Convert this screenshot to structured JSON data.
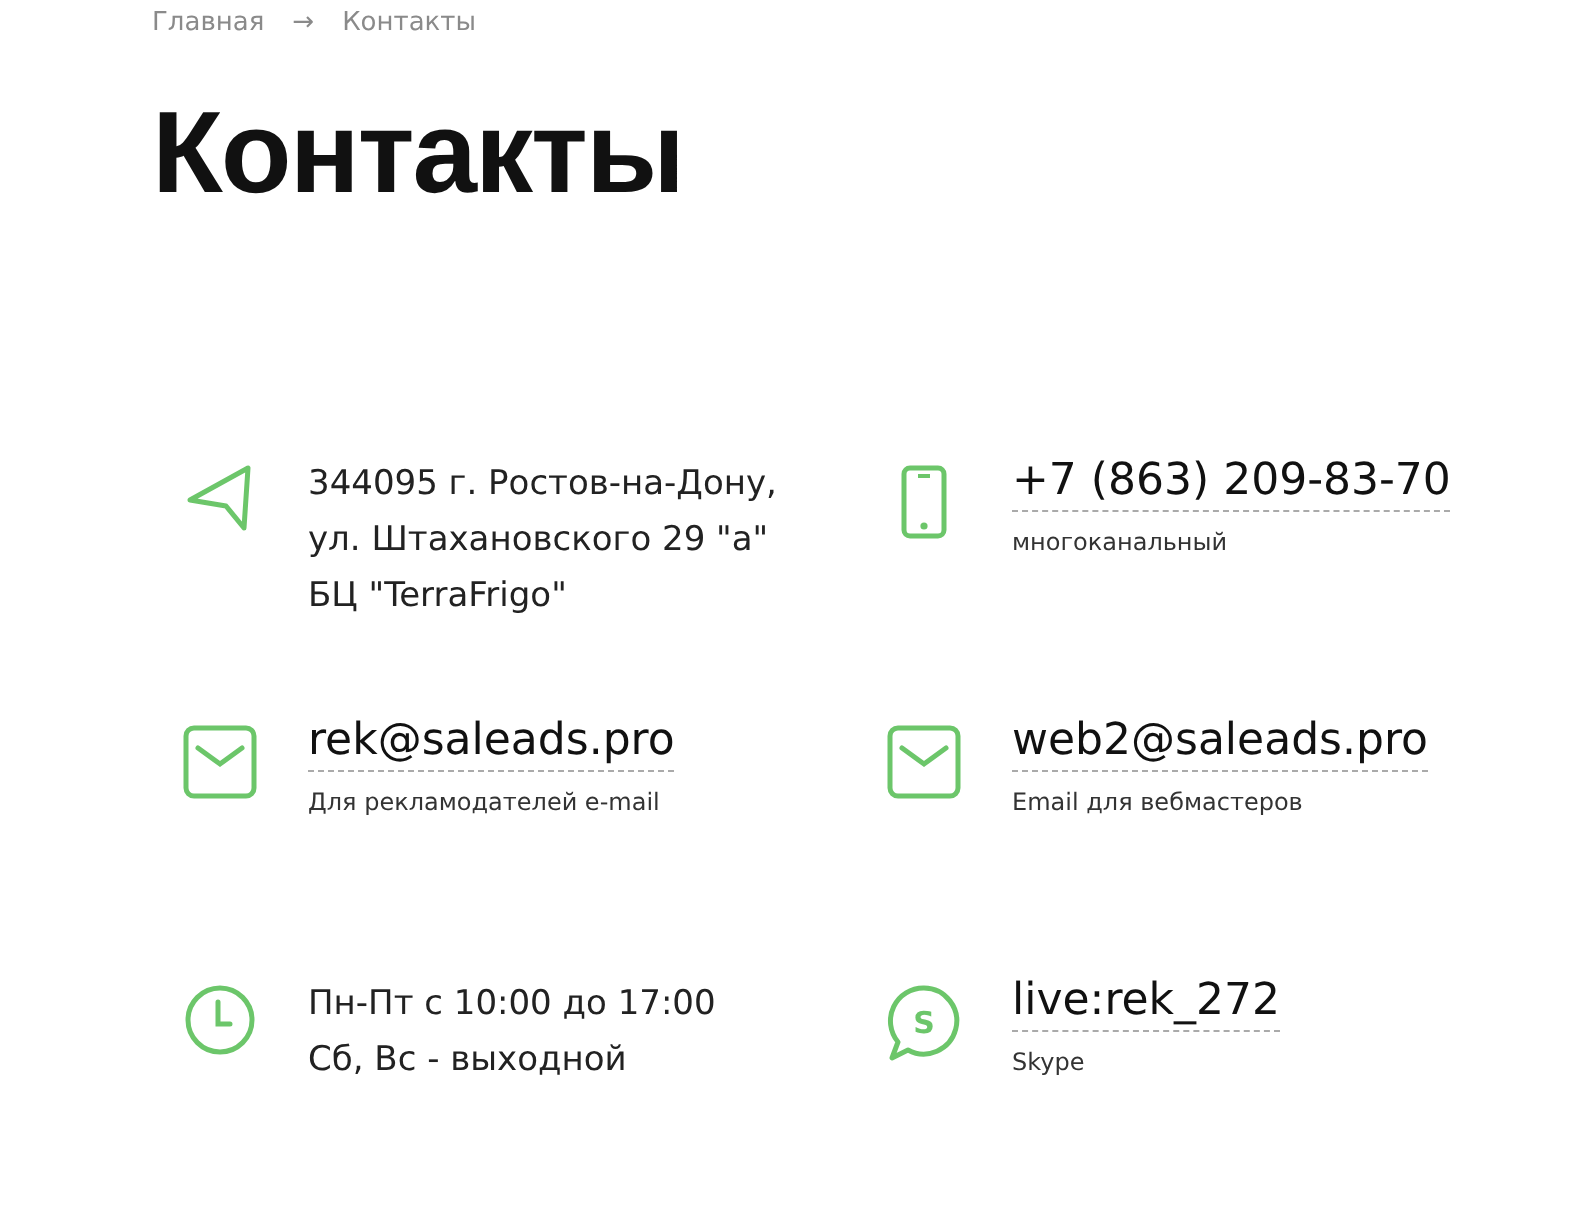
{
  "breadcrumbs": [
    {
      "label": "Главная"
    },
    {
      "label": "→"
    },
    {
      "label": "Контакты"
    }
  ],
  "title": "Контакты",
  "contacts": [
    {
      "kind": "address",
      "lines": [
        "344095 г. Ростов-на-Дону,",
        "ул. Штахановского 29 \"а\"",
        "БЦ \"TerraFrigo\""
      ]
    },
    {
      "kind": "phone",
      "value": "+7 (863) 209-83-70",
      "note": "многоканальный"
    },
    {
      "kind": "email",
      "value": "rek@saleads.pro",
      "note": "Для рекламодателей e-mail"
    },
    {
      "kind": "email",
      "value": "web2@saleads.pro",
      "note": "Email для вебмастеров"
    },
    {
      "kind": "hours",
      "lines": [
        "Пн-Пт с 10:00 до 17:00",
        "Сб, Вс - выходной"
      ]
    },
    {
      "kind": "skype",
      "icon_letter": "S",
      "value": "live:rek_272",
      "note": "Skype"
    }
  ]
}
